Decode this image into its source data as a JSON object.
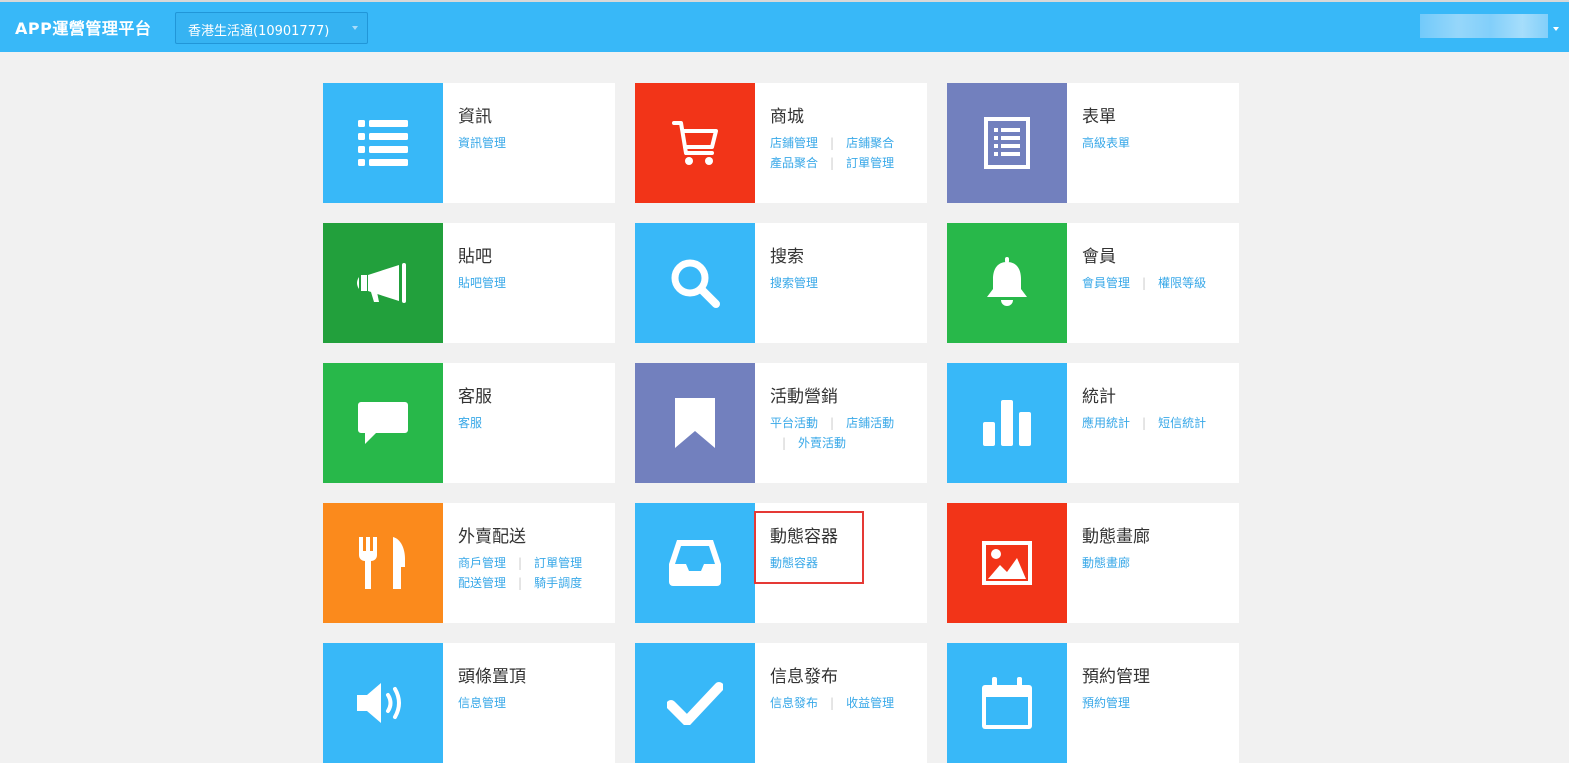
{
  "header": {
    "app_title": "APP運營管理平台",
    "org_select_value": "香港生活通(10901777)"
  },
  "colors": {
    "header_bg": "#38b8f8",
    "blue": "#38b8f8",
    "red": "#f23418",
    "purple": "#7280be",
    "dark_green": "#22a03c",
    "green": "#28b84a",
    "orange": "#fb8a1c",
    "link": "#38a8e8"
  },
  "modules": [
    {
      "title": "資訊",
      "color": "blue",
      "icon": "list-icon",
      "links": [
        "資訊管理"
      ]
    },
    {
      "title": "商城",
      "color": "red",
      "icon": "cart-icon",
      "links": [
        "店鋪管理",
        "店鋪聚合",
        "產品聚合",
        "訂單管理"
      ]
    },
    {
      "title": "表單",
      "color": "purple",
      "icon": "form-icon",
      "links": [
        "高級表單"
      ]
    },
    {
      "title": "貼吧",
      "color": "dark_green",
      "icon": "megaphone-icon",
      "links": [
        "貼吧管理"
      ]
    },
    {
      "title": "搜索",
      "color": "blue",
      "icon": "search-icon",
      "links": [
        "搜索管理"
      ]
    },
    {
      "title": "會員",
      "color": "green",
      "icon": "bell-icon",
      "links": [
        "會員管理",
        "權限等級"
      ]
    },
    {
      "title": "客服",
      "color": "green",
      "icon": "chat-icon",
      "links": [
        "客服"
      ]
    },
    {
      "title": "活動營銷",
      "color": "purple",
      "icon": "bookmark-icon",
      "links": [
        "平台活動",
        "店鋪活動",
        "外賣活動"
      ]
    },
    {
      "title": "統計",
      "color": "blue",
      "icon": "bar-chart-icon",
      "links": [
        "應用統計",
        "短信統計"
      ]
    },
    {
      "title": "外賣配送",
      "color": "orange",
      "icon": "cutlery-icon",
      "links": [
        "商戶管理",
        "訂單管理",
        "配送管理",
        "騎手調度"
      ]
    },
    {
      "title": "動態容器",
      "color": "blue",
      "icon": "inbox-icon",
      "links": [
        "動態容器"
      ]
    },
    {
      "title": "動態畫廊",
      "color": "red",
      "icon": "picture-icon",
      "links": [
        "動態畫廊"
      ]
    },
    {
      "title": "頭條置頂",
      "color": "blue",
      "icon": "volume-icon",
      "links": [
        "信息管理"
      ]
    },
    {
      "title": "信息發布",
      "color": "blue",
      "icon": "check-icon",
      "links": [
        "信息發布",
        "收益管理"
      ]
    },
    {
      "title": "預約管理",
      "color": "blue",
      "icon": "calendar-icon",
      "links": [
        "預約管理"
      ]
    }
  ]
}
